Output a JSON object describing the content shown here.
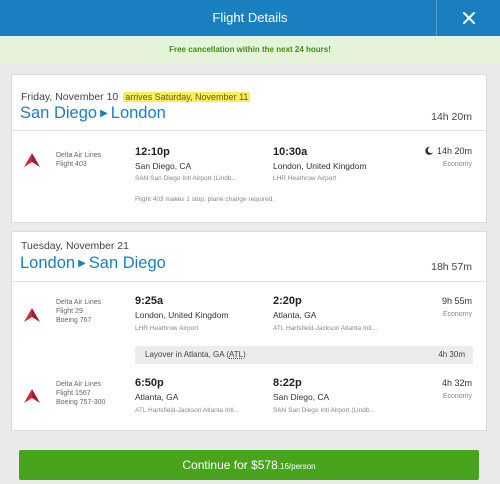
{
  "header": {
    "title": "Flight Details",
    "close_label": "✕"
  },
  "banner": "Free cancellation within the next 24 hours!",
  "outbound": {
    "date": "Friday, November 10",
    "arrival_note": "arrives Saturday, November 11",
    "origin": "San Diego",
    "destination": "London",
    "total_duration": "14h 20m",
    "segment": {
      "airline": "Delta Air Lines",
      "flight": "Flight 403",
      "depart_time": "12:10p",
      "depart_place": "San Diego, CA",
      "depart_airport": "SAN San Diego Intl Airport (Lindb...",
      "arrive_time": "10:30a",
      "arrive_place": "London, United Kingdom",
      "arrive_airport": "LHR Heathrow Airport",
      "duration": "14h 20m",
      "cabin": "Economy",
      "note": "Flight 403 makes 1 stop, plane change required."
    }
  },
  "return": {
    "date": "Tuesday, November 21",
    "origin": "London",
    "destination": "San Diego",
    "total_duration": "18h 57m",
    "segments": [
      {
        "airline": "Delta Air Lines",
        "flight": "Flight 29",
        "aircraft": "Boeing 767",
        "depart_time": "9:25a",
        "depart_place": "London, United Kingdom",
        "depart_airport": "LHR Heathrow Airport",
        "arrive_time": "2:20p",
        "arrive_place": "Atlanta, GA",
        "arrive_airport": "ATL Hartsfield-Jackson Atlanta Intl...",
        "duration": "9h 55m",
        "cabin": "Economy"
      },
      {
        "airline": "Delta Air Lines",
        "flight": "Flight 1567",
        "aircraft": "Boeing 757-300",
        "depart_time": "6:50p",
        "depart_place": "Atlanta, GA",
        "depart_airport": "ATL Hartsfield-Jackson Atlanta Intl...",
        "arrive_time": "8:22p",
        "arrive_place": "San Diego, CA",
        "arrive_airport": "SAN San Diego Intl Airport (Lindb...",
        "duration": "4h 32m",
        "cabin": "Economy"
      }
    ],
    "layover": {
      "prefix": "Layover in Atlanta, GA (",
      "code": "ATL",
      "suffix": ")",
      "duration": "4h 30m"
    }
  },
  "cta": {
    "prefix": "Continue for $578",
    "cents": ".16/person"
  },
  "colors": {
    "header": "#1a7fc1",
    "banner_bg": "#e5f4d8",
    "banner_text": "#3f8c1e",
    "route": "#1a7fc1",
    "cta": "#47a41c",
    "highlight": "#f7ee5e"
  },
  "icons": {
    "close": "close-icon",
    "airline_logo": "delta-logo-icon",
    "overnight": "moon-icon",
    "route_separator": "triangle-right-icon"
  }
}
